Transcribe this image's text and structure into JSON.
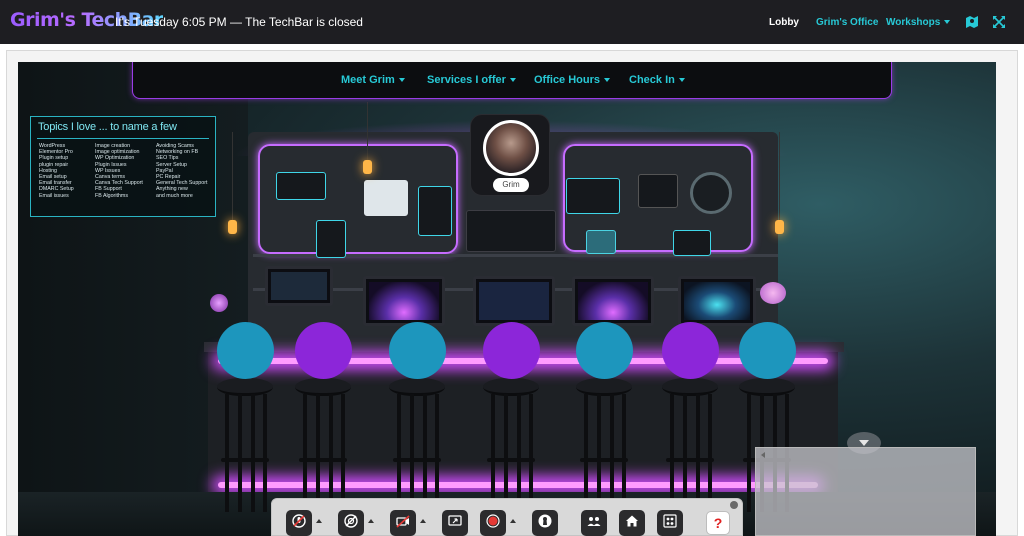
{
  "header": {
    "logo": "Grim's TechBar",
    "status": "It's Tuesday 6:05 PM — The TechBar is closed",
    "nav": [
      {
        "label": "Lobby"
      },
      {
        "label": "Grim's Office"
      },
      {
        "label": "Workshops"
      }
    ]
  },
  "subnav": {
    "items": [
      {
        "label": "Meet Grim"
      },
      {
        "label": "Services I offer"
      },
      {
        "label": "Office Hours"
      },
      {
        "label": "Check In"
      }
    ]
  },
  "topics": {
    "title": "Topics I love ... to name a few",
    "col1": [
      "WordPress",
      "Elementor Pro",
      "Plugin setup",
      "plugin repair",
      "Hosting",
      "Email setup",
      "Email transfer",
      "DMARC Setup",
      "Email issues"
    ],
    "col2": [
      "Image creation",
      "Image optimization",
      "WP Optimization",
      "Plugin Issues",
      "WP Issues",
      "Canva terms",
      "Canva Tech Support",
      "FB Support",
      "FB Algorithms"
    ],
    "col3": [
      "Avoiding Scams",
      "Networking on FB",
      "SEO Tips",
      "Server Setup",
      "PayPal",
      "PC Repair",
      "General Tech Support",
      "Anything new",
      "and much more"
    ]
  },
  "host": {
    "name": "Grim"
  },
  "seats": {
    "colors": [
      "#1d96bd",
      "#8c26d9",
      "#1d96bd",
      "#8c26d9",
      "#1d96bd",
      "#8c26d9",
      "#1d96bd"
    ]
  },
  "toolbar": {
    "help_label": "?",
    "icons": [
      "mic-off-icon",
      "camera-off-icon",
      "video-off-icon",
      "screen-share-icon",
      "record-icon",
      "lock-icon",
      "people-icon",
      "home-icon",
      "grid-people-icon",
      "help-icon"
    ]
  },
  "colors": {
    "accent": "#27c9d6",
    "neon_purple": "#c66cff",
    "seat_teal": "#1d96bd",
    "seat_purple": "#8c26d9",
    "topbar_bg": "#1e1e22"
  }
}
